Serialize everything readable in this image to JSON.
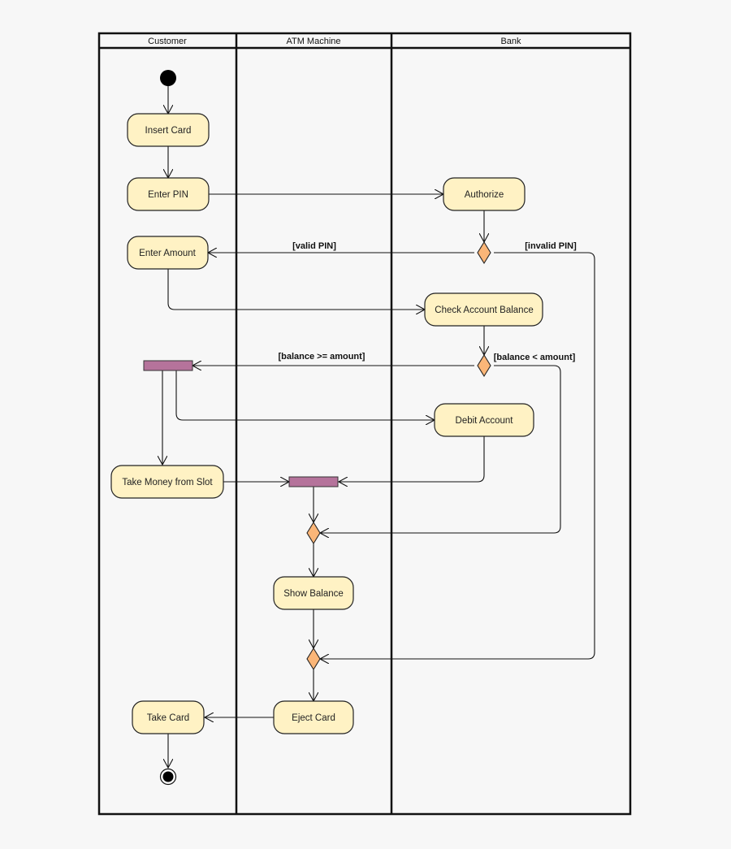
{
  "diagram": {
    "type": "UML activity diagram",
    "colors": {
      "background": "#f7f7f7",
      "action_fill": "#fff2c4",
      "decision_fill": "#fbb678",
      "fork_join_fill": "#b5739b",
      "line": "#111111"
    },
    "swimlanes": [
      {
        "id": "customer",
        "title": "Customer"
      },
      {
        "id": "atm",
        "title": "ATM Machine"
      },
      {
        "id": "bank",
        "title": "Bank"
      }
    ],
    "actions": [
      {
        "id": "insert_card",
        "label": "Insert Card",
        "lane": "customer"
      },
      {
        "id": "enter_pin",
        "label": "Enter PIN",
        "lane": "customer"
      },
      {
        "id": "authorize",
        "label": "Authorize",
        "lane": "bank"
      },
      {
        "id": "enter_amount",
        "label": "Enter Amount",
        "lane": "customer"
      },
      {
        "id": "check_balance",
        "label": "Check Account Balance",
        "lane": "bank"
      },
      {
        "id": "debit_account",
        "label": "Debit Account",
        "lane": "bank"
      },
      {
        "id": "take_money",
        "label": "Take Money from Slot",
        "lane": "customer"
      },
      {
        "id": "show_balance",
        "label": "Show Balance",
        "lane": "atm"
      },
      {
        "id": "eject_card",
        "label": "Eject Card",
        "lane": "atm"
      },
      {
        "id": "take_card",
        "label": "Take Card",
        "lane": "customer"
      }
    ],
    "guards": {
      "valid_pin": "[valid PIN]",
      "invalid_pin": "[invalid PIN]",
      "balance_ok": "[balance >= amount]",
      "balance_low": "[balance < amount]"
    }
  }
}
